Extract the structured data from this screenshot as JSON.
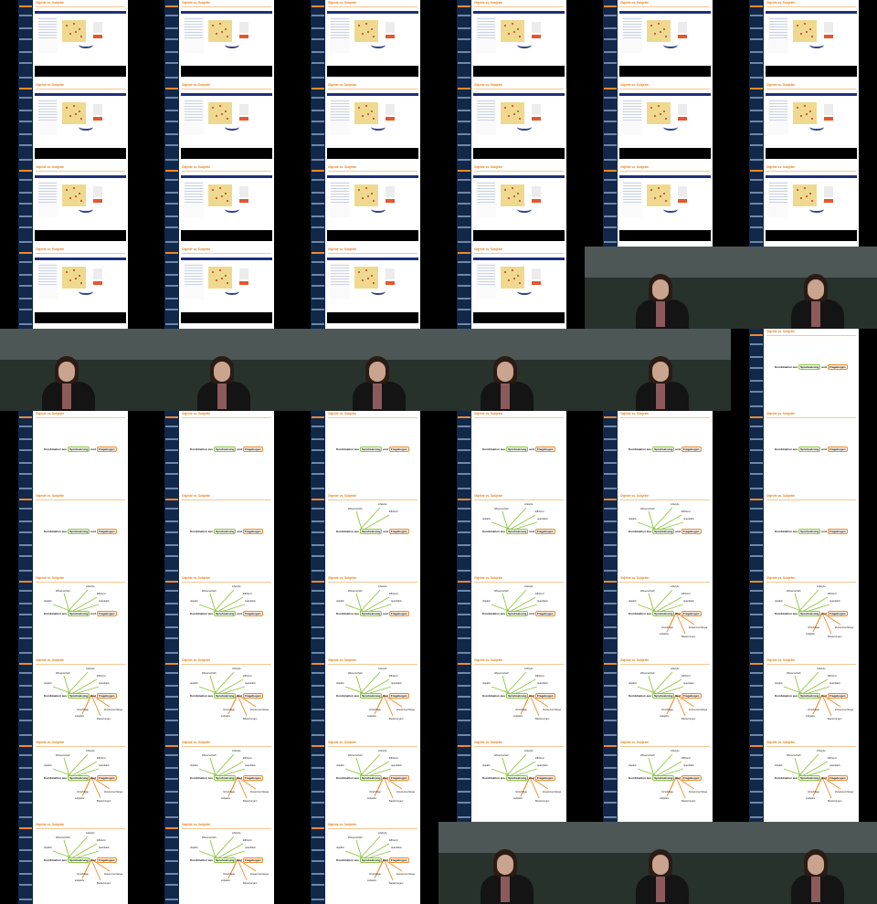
{
  "slide": {
    "title": "Objekte vs. Subjekte",
    "combo_prefix": "Kombination aus",
    "combo_term1": "Sprahsatzung",
    "combo_join": "und",
    "combo_term2": "Fragebogen"
  },
  "sidebar": {
    "items": [
      "Problem-stellung",
      "Vorarbeiten / Ansatz",
      "Ergebnisse",
      "Zusammenfassung",
      "Folie 1"
    ]
  },
  "mindmap": {
    "green_labels": [
      "Lifestyle",
      "Wissenschaft",
      "Effizienz",
      "objektiv",
      "quantitativ"
    ],
    "orange_labels": [
      "Vorschläge",
      "Zusammenhänge",
      "subjektiv",
      "Bewertungen"
    ]
  },
  "colors": {
    "sidebar": "#12284a",
    "accent": "#e6821e",
    "green": "#8cc63f",
    "orange": "#f08a2a",
    "map_yellow": "#efd98f"
  },
  "grid": {
    "columns": 6,
    "rows": 11
  },
  "frames": [
    "map",
    "map",
    "map",
    "map",
    "map",
    "map",
    "map",
    "map",
    "map",
    "map",
    "map",
    "map",
    "map",
    "map",
    "map",
    "map",
    "map",
    "map",
    "map",
    "map",
    "map",
    "map",
    "speaker",
    "speaker",
    "speaker",
    "speaker",
    "speaker",
    "speaker",
    "speaker",
    "combo",
    "combo",
    "combo",
    "combo",
    "combo",
    "combo",
    "combo",
    "combo",
    "combo",
    "mm1",
    "mm2",
    "mm3",
    "combo",
    "mm3",
    "mm3",
    "mm3",
    "mm3f",
    "mm4",
    "mm4",
    "mm4",
    "mm4",
    "mm4",
    "mm4",
    "mm4",
    "mm4",
    "mm4",
    "mm4",
    "mm4",
    "mm4",
    "mm4",
    "mm4",
    "mm4",
    "mm4",
    "mm4",
    "speaker",
    "speaker",
    "speaker"
  ]
}
